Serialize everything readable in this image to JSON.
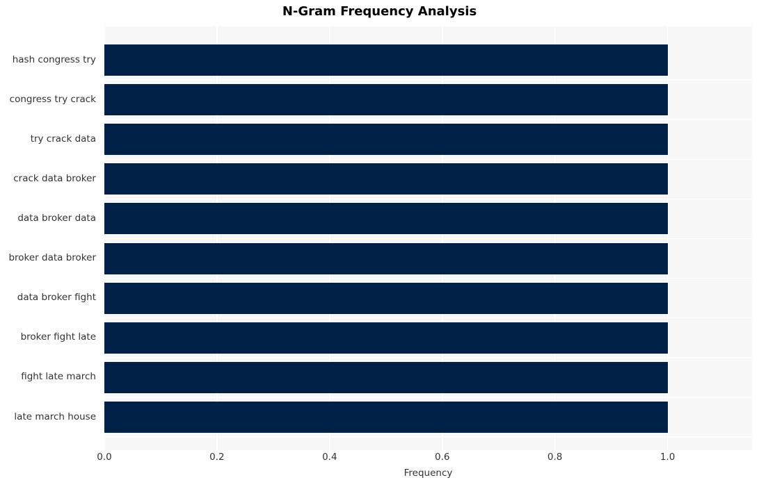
{
  "chart_data": {
    "type": "bar",
    "orientation": "horizontal",
    "title": "N-Gram Frequency Analysis",
    "xlabel": "Frequency",
    "ylabel": "",
    "categories": [
      "hash congress try",
      "congress try crack",
      "try crack data",
      "crack data broker",
      "data broker data",
      "broker data broker",
      "data broker fight",
      "broker fight late",
      "fight late march",
      "late march house"
    ],
    "values": [
      1.0,
      1.0,
      1.0,
      1.0,
      1.0,
      1.0,
      1.0,
      1.0,
      1.0,
      1.0
    ],
    "xlim": [
      0.0,
      1.15
    ],
    "xticks": [
      "0.0",
      "0.2",
      "0.4",
      "0.6",
      "0.8",
      "1.0"
    ],
    "xtick_values": [
      0.0,
      0.2,
      0.4,
      0.6,
      0.8,
      1.0
    ],
    "grid": true,
    "legend": null,
    "bar_color": "#002147",
    "plot_background": "#f7f7f7",
    "figure_background": "#ffffff",
    "grid_color": "#ffffff",
    "tick_label_color": "#333333",
    "title_color": "#000000"
  }
}
